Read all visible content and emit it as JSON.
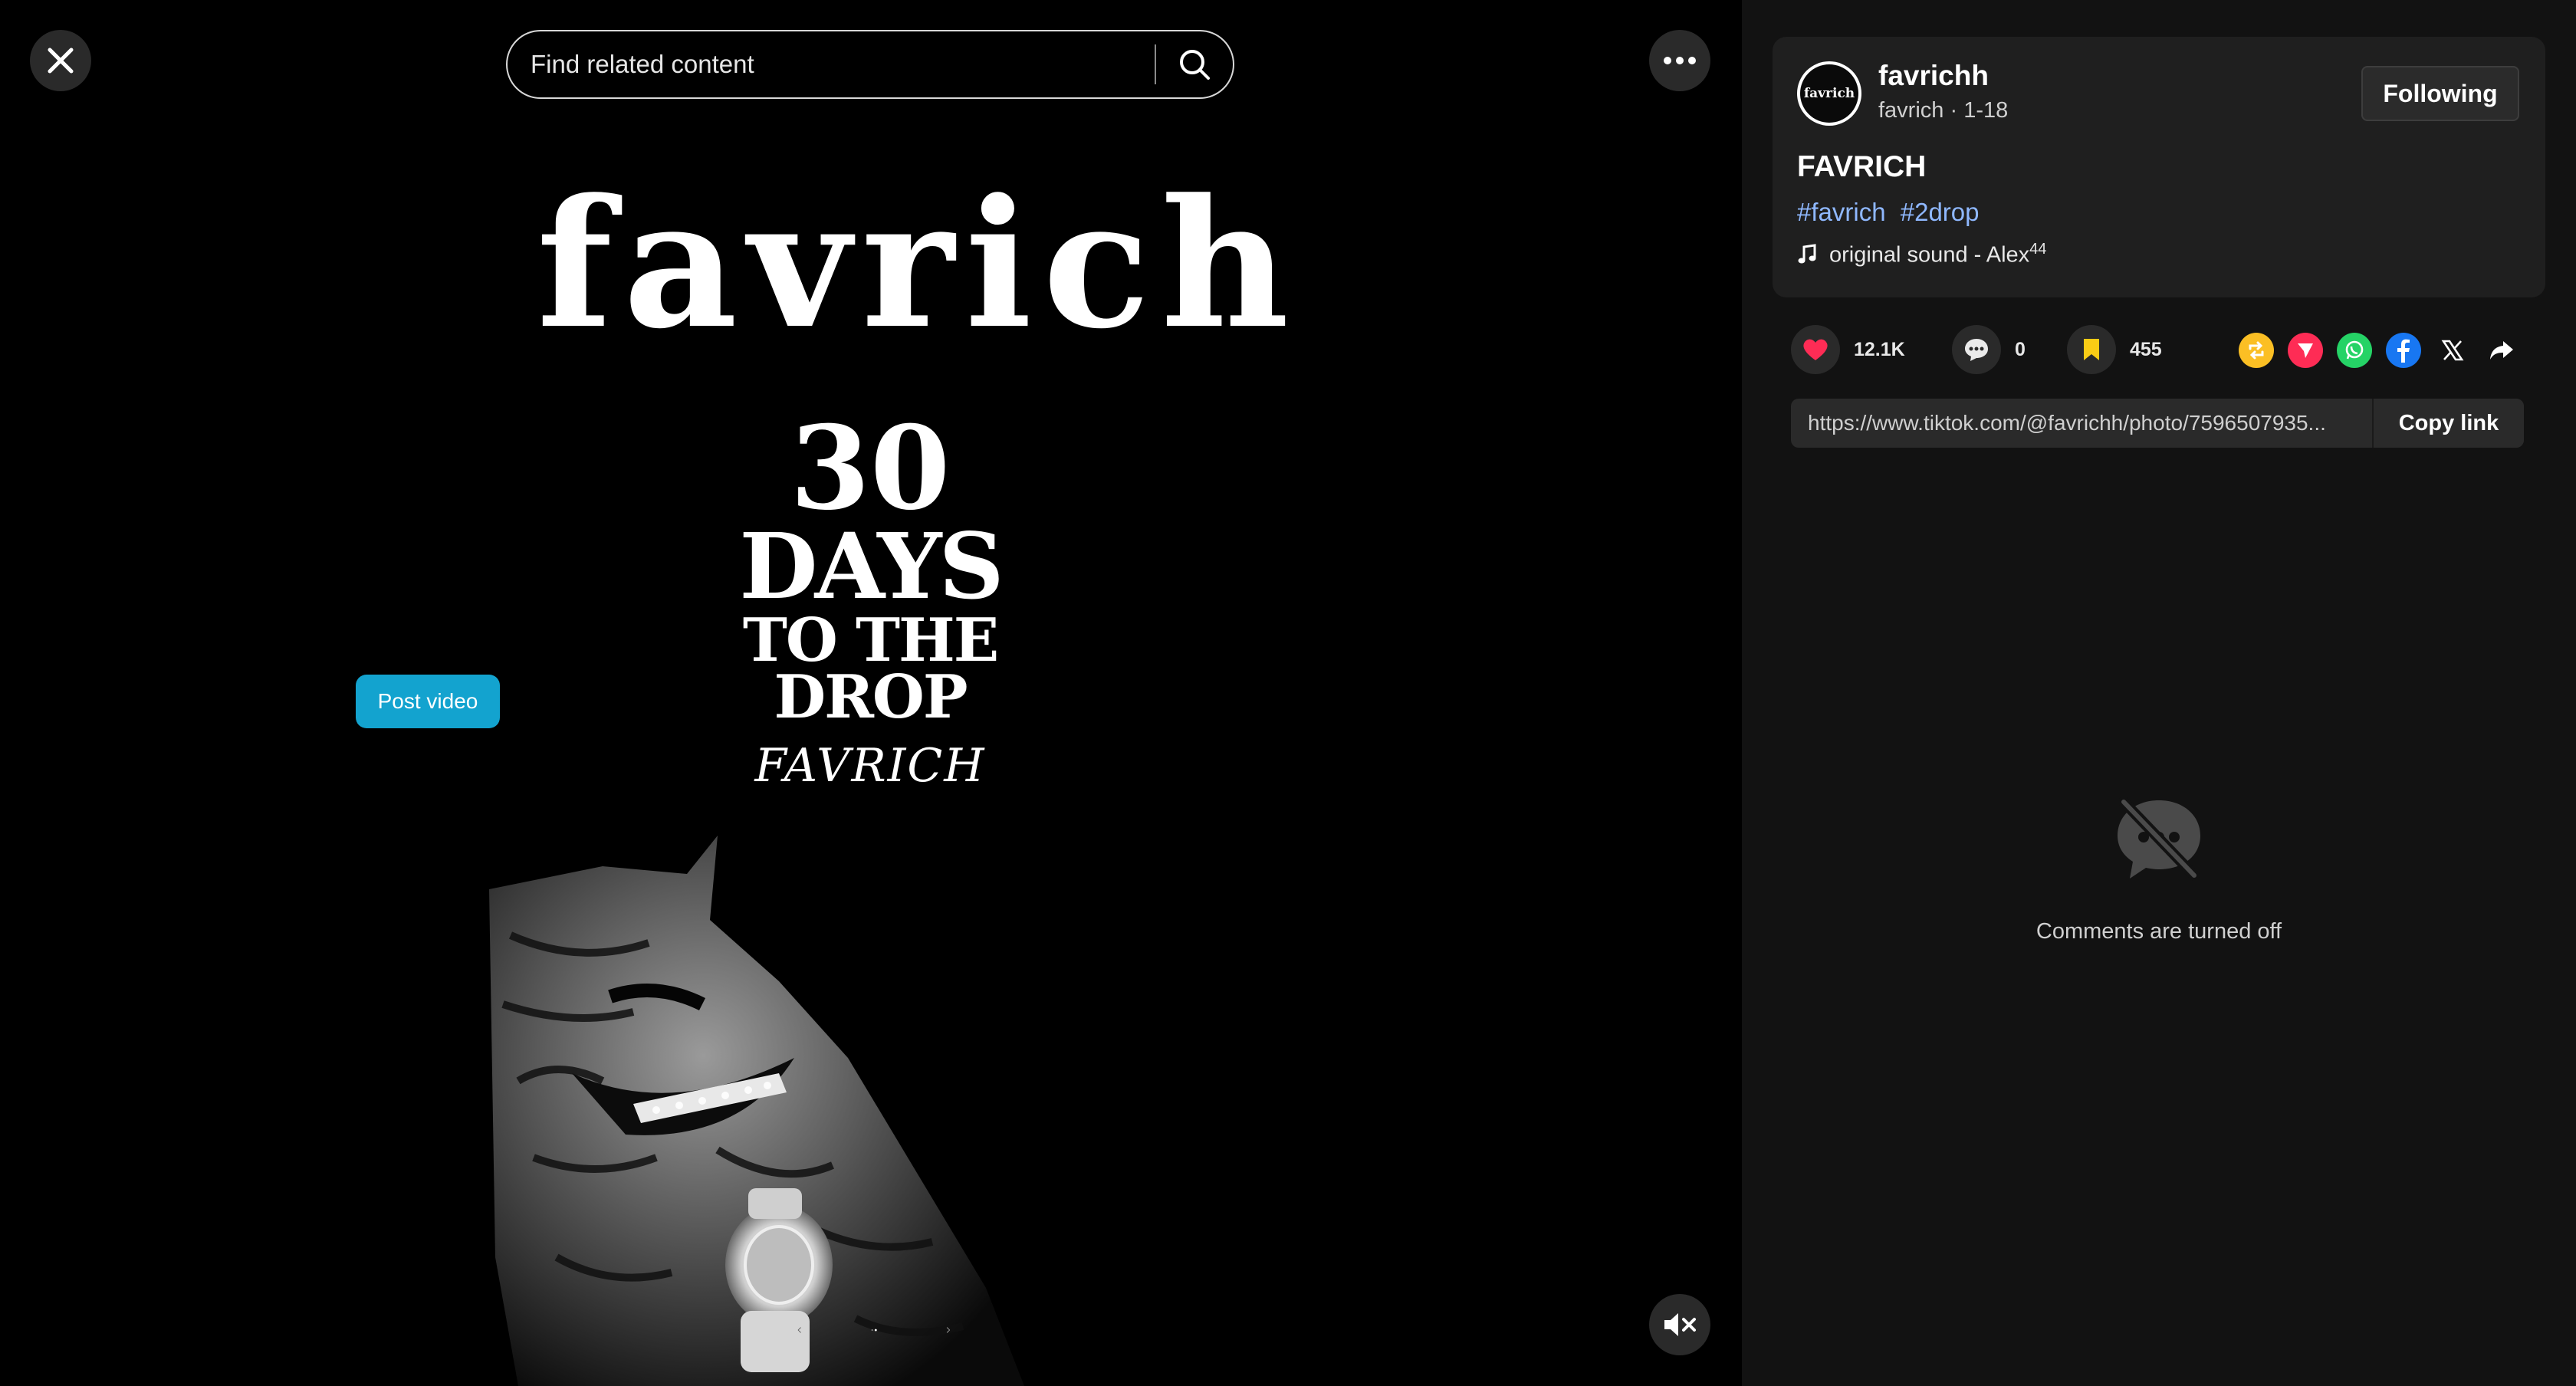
{
  "search": {
    "placeholder": "Find related content"
  },
  "post_video_label": "Post video",
  "artwork": {
    "logo": "favrich",
    "days_number": "30",
    "days_word": "DAYS",
    "days_sub": "TO THE DROP",
    "brand_script": "FAVRICH"
  },
  "author": {
    "avatar_text": "favrich",
    "username": "favrichh",
    "nickname": "favrich",
    "date": "1-18",
    "follow_label": "Following"
  },
  "post": {
    "title": "FAVRICH",
    "hashtags": [
      "#favrich",
      "#2drop"
    ],
    "sound": "original sound - Alex",
    "sound_sup": "44"
  },
  "stats": {
    "likes": "12.1K",
    "comments": "0",
    "saves": "455"
  },
  "share_icons": [
    "repost-icon",
    "send-icon",
    "whatsapp-icon",
    "facebook-icon",
    "x-icon",
    "share-icon"
  ],
  "link": {
    "url": "https://www.tiktok.com/@favrichh/photo/7596507935...",
    "copy_label": "Copy link"
  },
  "comments_off": "Comments are turned off",
  "colors": {
    "like": "#fe2c55",
    "save": "#facc15",
    "accent_button": "#13a3cf",
    "hashtag": "#8fb8ff",
    "repost": "#fbbf24",
    "send": "#fe2c55",
    "whatsapp": "#25d366",
    "facebook": "#1877f2"
  },
  "carousel": {
    "slide_count": 2,
    "current_slide": 2
  }
}
